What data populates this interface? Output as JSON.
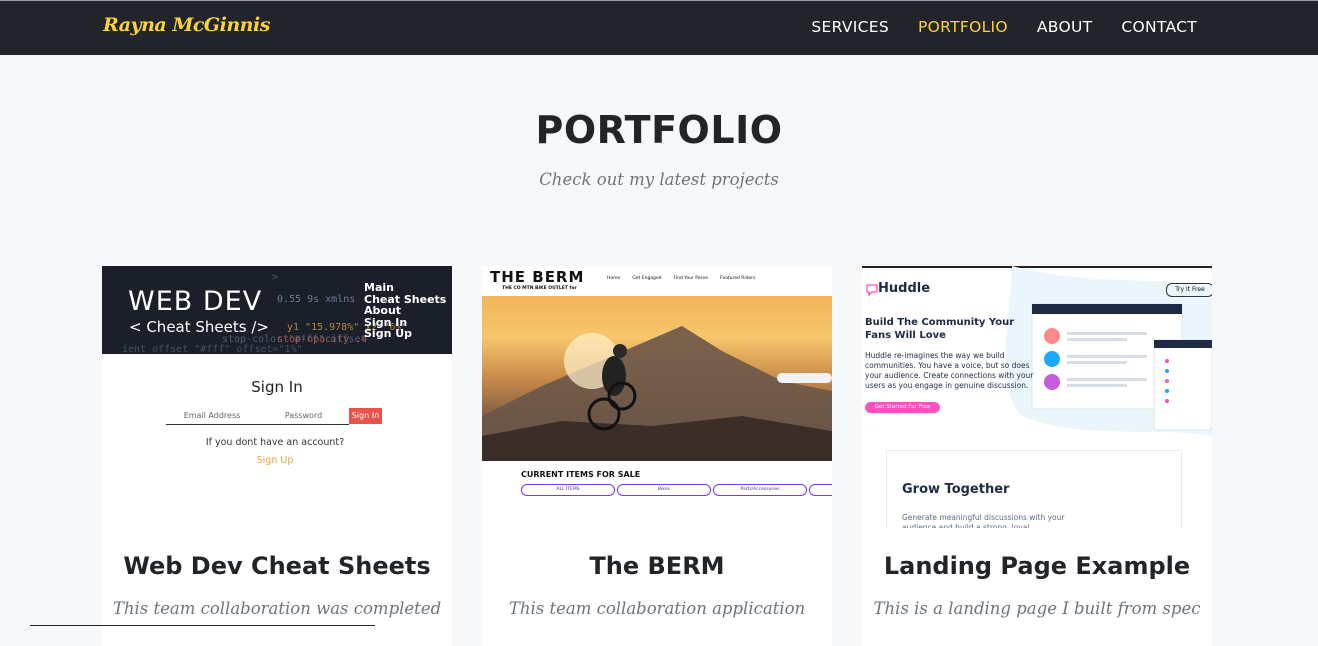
{
  "navbar": {
    "brand": "Rayna McGinnis",
    "links": [
      "SERVICES",
      "PORTFOLIO",
      "ABOUT",
      "CONTACT"
    ],
    "active": "PORTFOLIO"
  },
  "section": {
    "title": "PORTFOLIO",
    "subtitle": "Check out my latest projects"
  },
  "projects": [
    {
      "title": "Web Dev Cheat Sheets",
      "description": "This team collaboration was completed",
      "thumb": {
        "big_text": "WEB DEV",
        "small_text": "< Cheat Sheets />",
        "menu": [
          "Main",
          "Cheat Sheets",
          "About",
          "Sign In",
          "Sign Up"
        ],
        "heading": "Sign In",
        "email_placeholder": "Email Address",
        "password_placeholder": "Password",
        "button": "Sign In",
        "no_account": "If you dont have an account?",
        "signup": "Sign Up"
      }
    },
    {
      "title": "The BERM",
      "description": "This team collaboration application",
      "thumb": {
        "logo_prefix": "THE BERM",
        "tagline": "THE CO MTN BIKE OUTLET for",
        "links": [
          "Home",
          "Get Engaged",
          "Find Your Posse",
          "Featured Riders"
        ],
        "section": "CURRENT ITEMS FOR SALE",
        "pills": [
          "ALL ITEMS",
          "Bikes",
          "Parts/Accessories"
        ]
      }
    },
    {
      "title": "Landing Page Example",
      "description": "This is a landing page I built from spec",
      "thumb": {
        "logo": "Huddle",
        "try_button": "Try It Free",
        "headline": "Build The Community Your Fans Will Love",
        "body": "Huddle re-imagines the way we build communities. You have a voice, but so does your audience. Create connections with your users as you engage in genuine discussion.",
        "cta": "Get Started For Free",
        "section": "Grow Together",
        "section_body": "Generate meaningful discussions with your audience and build a strong, loyal"
      }
    }
  ],
  "colors": {
    "navbar_bg": "#212529",
    "accent": "#fed136",
    "page_bg": "#f7f8fa"
  }
}
